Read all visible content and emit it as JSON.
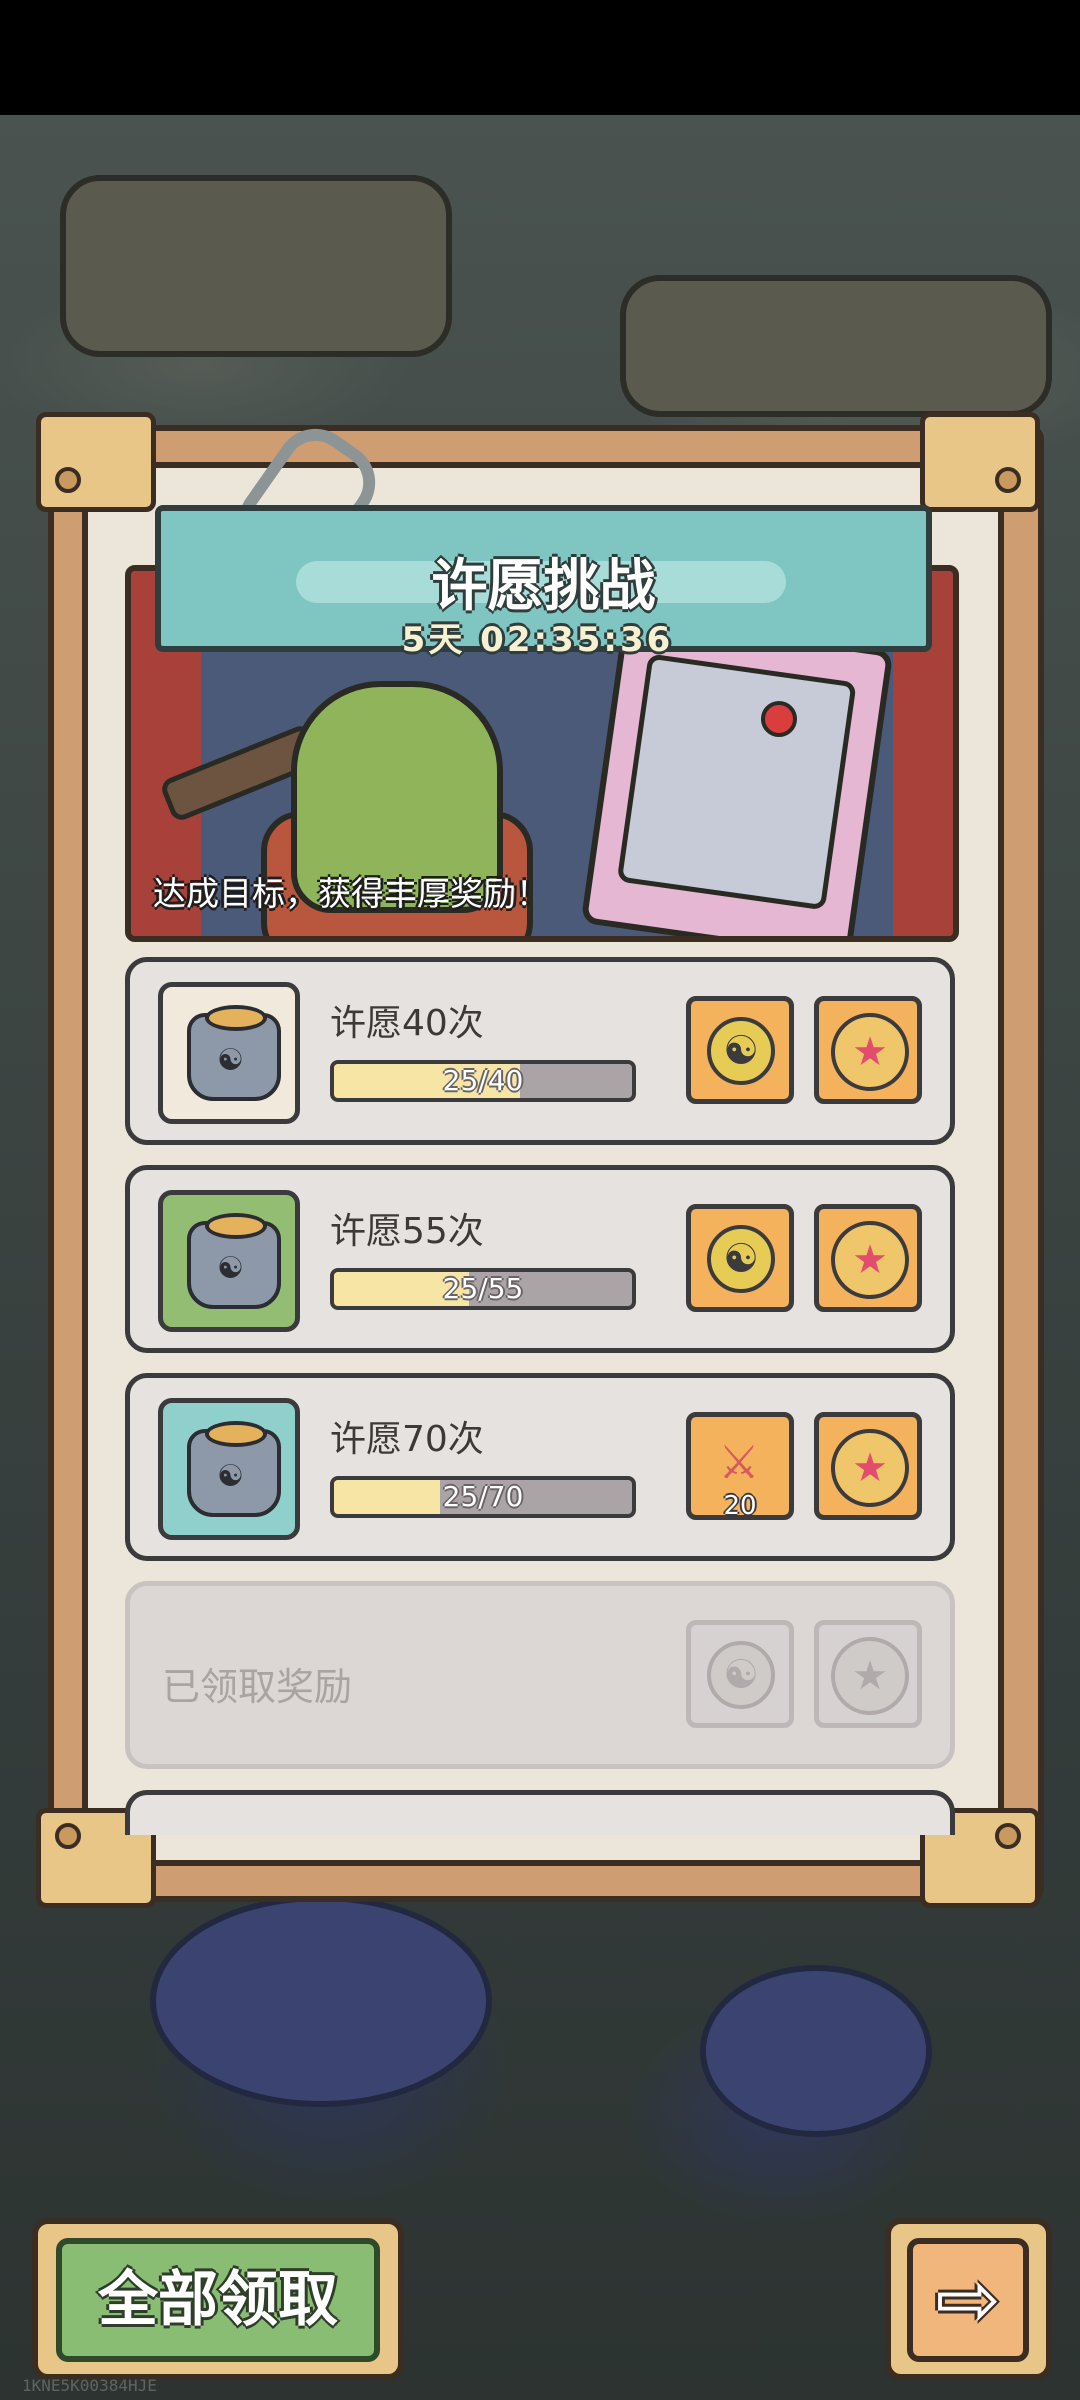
{
  "header": {
    "title": "许愿挑战",
    "countdown": "5天 02:35:36",
    "banner_caption": "达成目标，获得丰厚奖励！"
  },
  "tasks": [
    {
      "label": "许愿40次",
      "progress_text": "25/40",
      "current": 25,
      "target": 40,
      "thumb_color": "#f0e9dc",
      "rewards": [
        "coin-icon",
        "medal-icon"
      ]
    },
    {
      "label": "许愿55次",
      "progress_text": "25/55",
      "current": 25,
      "target": 55,
      "thumb_color": "#93bd72",
      "rewards": [
        "coin-icon",
        "medal-icon"
      ]
    },
    {
      "label": "许愿70次",
      "progress_text": "25/70",
      "current": 25,
      "target": 70,
      "thumb_color": "#8fd0cc",
      "rewards": [
        "swords-icon",
        "medal-icon"
      ],
      "reward_count": "20"
    }
  ],
  "claimed_row": {
    "label": "已领取奖励"
  },
  "buttons": {
    "claim_all": "全部领取",
    "next_arrow": "⇨"
  },
  "footer": {
    "uid": "1KNE5K00384HJE"
  },
  "colors": {
    "panel_wood": "#cf9d72",
    "paper": "#ece6da",
    "banner": "#7fc5c1",
    "claim_button": "#89bd74",
    "reward_tile": "#f3b25b"
  }
}
